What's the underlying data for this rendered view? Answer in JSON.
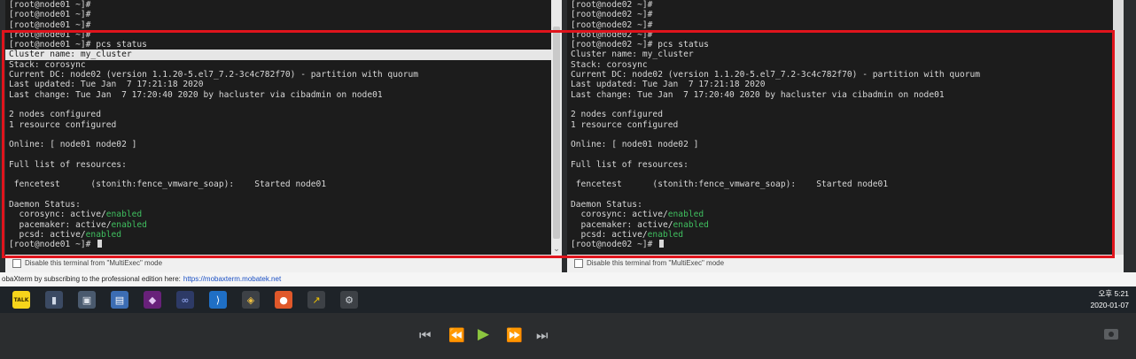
{
  "left_terminal": {
    "lines": [
      {
        "text": "[root@node01 ~]#"
      },
      {
        "text": "[root@node01 ~]#"
      },
      {
        "text": "[root@node01 ~]#"
      },
      {
        "text": "[root@node01 ~]#"
      },
      {
        "text": "[root@node01 ~]# pcs status"
      },
      {
        "text": "Cluster name: my_cluster",
        "highlighted": true
      },
      {
        "text": "Stack: corosync"
      },
      {
        "text": "Current DC: node02 (version 1.1.20-5.el7_7.2-3c4c782f70) - partition with quorum"
      },
      {
        "text": "Last updated: Tue Jan  7 17:21:18 2020"
      },
      {
        "text": "Last change: Tue Jan  7 17:20:40 2020 by hacluster via cibadmin on node01"
      },
      {
        "text": ""
      },
      {
        "text": "2 nodes configured"
      },
      {
        "text": "1 resource configured"
      },
      {
        "text": ""
      },
      {
        "text": "Online: [ node01 node02 ]"
      },
      {
        "text": ""
      },
      {
        "text": "Full list of resources:"
      },
      {
        "text": ""
      },
      {
        "text": " fencetest      (stonith:fence_vmware_soap):    Started node01"
      },
      {
        "text": ""
      },
      {
        "text": "Daemon Status:"
      },
      {
        "text": "  corosync: active/",
        "status": "enabled"
      },
      {
        "text": "  pacemaker: active/",
        "status": "enabled"
      },
      {
        "text": "  pcsd: active/",
        "status": "enabled"
      },
      {
        "text": "[root@node01 ~]# ",
        "cursor": true
      }
    ],
    "option_label": "Disable this terminal from \"MultiExec\" mode"
  },
  "right_terminal": {
    "lines": [
      {
        "text": "[root@node02 ~]#"
      },
      {
        "text": "[root@node02 ~]#"
      },
      {
        "text": "[root@node02 ~]#"
      },
      {
        "text": "[root@node02 ~]#"
      },
      {
        "text": "[root@node02 ~]# pcs status"
      },
      {
        "text": "Cluster name: my_cluster"
      },
      {
        "text": "Stack: corosync"
      },
      {
        "text": "Current DC: node02 (version 1.1.20-5.el7_7.2-3c4c782f70) - partition with quorum"
      },
      {
        "text": "Last updated: Tue Jan  7 17:21:18 2020"
      },
      {
        "text": "Last change: Tue Jan  7 17:20:40 2020 by hacluster via cibadmin on node01"
      },
      {
        "text": ""
      },
      {
        "text": "2 nodes configured"
      },
      {
        "text": "1 resource configured"
      },
      {
        "text": ""
      },
      {
        "text": "Online: [ node01 node02 ]"
      },
      {
        "text": ""
      },
      {
        "text": "Full list of resources:"
      },
      {
        "text": ""
      },
      {
        "text": " fencetest      (stonith:fence_vmware_soap):    Started node01"
      },
      {
        "text": ""
      },
      {
        "text": "Daemon Status:"
      },
      {
        "text": "  corosync: active/",
        "status": "enabled"
      },
      {
        "text": "  pacemaker: active/",
        "status": "enabled"
      },
      {
        "text": "  pcsd: active/",
        "status": "enabled"
      },
      {
        "text": "[root@node02 ~]# ",
        "cursor": true
      }
    ],
    "option_label": "Disable this terminal from \"MultiExec\" mode"
  },
  "promo": {
    "text": "obaXterm by subscribing to the professional edition here:",
    "link": "https://mobaxterm.mobatek.net"
  },
  "taskbar": {
    "icons": [
      {
        "name": "kakaotalk-icon",
        "glyph": "TALK",
        "color": "#f7d51b",
        "fg": "#3a2d00"
      },
      {
        "name": "terminal-app-icon",
        "glyph": "▮",
        "color": "#3b4a63",
        "fg": "#cfd8e6"
      },
      {
        "name": "monitor-app-icon",
        "glyph": "▣",
        "color": "#4a5a6e",
        "fg": "#dde3ea"
      },
      {
        "name": "document-app-icon",
        "glyph": "▤",
        "color": "#3c6db3",
        "fg": "#ffffff"
      },
      {
        "name": "visual-studio-icon",
        "glyph": "◆",
        "color": "#68217a",
        "fg": "#e3c8f2"
      },
      {
        "name": "link-app-icon",
        "glyph": "∞",
        "color": "#2d3a66",
        "fg": "#9fb4ff"
      },
      {
        "name": "vscode-icon",
        "glyph": "⟩",
        "color": "#1f6fc5",
        "fg": "#ffffff"
      },
      {
        "name": "git-app-icon",
        "glyph": "◈",
        "color": "#3d4146",
        "fg": "#f0c040"
      },
      {
        "name": "postman-icon",
        "glyph": "●",
        "color": "#e0582a",
        "fg": "#ffffff"
      },
      {
        "name": "pin-app-icon",
        "glyph": "↗",
        "color": "#3d4146",
        "fg": "#f2c300"
      },
      {
        "name": "settings-app-icon",
        "glyph": "⚙",
        "color": "#3d4146",
        "fg": "#cfd4da"
      }
    ],
    "clock_time": "오후 5:21",
    "clock_date": "2020-01-07"
  },
  "player": {
    "skip_back": "⏮",
    "rewind": "⏪",
    "play": "▶",
    "forward": "⏩",
    "skip_forward": "⏭"
  },
  "colors": {
    "terminal_bg": "#1c1c1c",
    "terminal_fg": "#d8d8d8",
    "enabled_green": "#3fbf5f",
    "highlight_box_red": "#e0141c"
  }
}
